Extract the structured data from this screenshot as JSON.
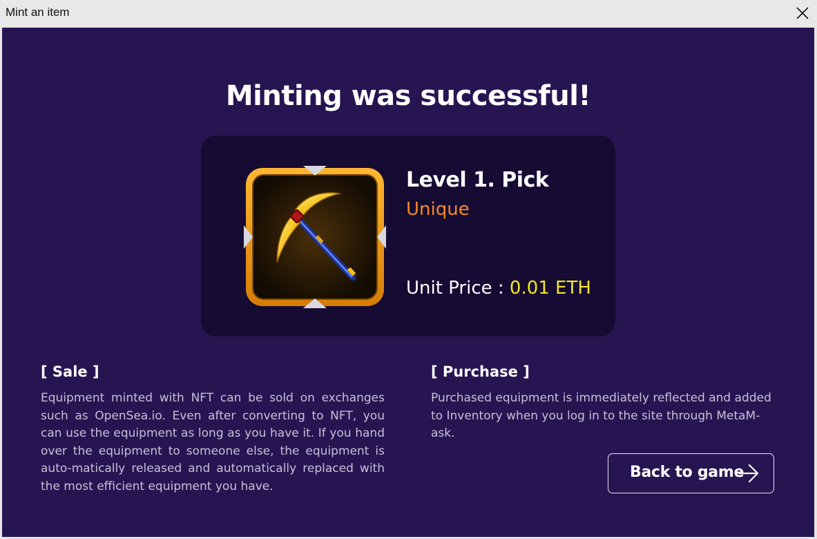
{
  "window": {
    "title": "Mint an item",
    "close_icon": "close-icon"
  },
  "main": {
    "heading": "Minting was successful!",
    "item": {
      "image_icon": "pickaxe-icon",
      "name": "Level 1. Pick",
      "rarity": "Unique",
      "price_label": "Unit Price : ",
      "price_value": "0.01 ETH"
    },
    "sale": {
      "title": "[ Sale ]",
      "body": "Equipment minted with NFT can be sold on exchanges such as OpenSea.io. Even after converting to NFT, you can use the equipment as long as you have it. If you hand over the equipment to someone else, the equipment is auto-matically released and automatically replaced with the most efficient equipment you have."
    },
    "purchase": {
      "title": "[ Purchase ]",
      "body": "Purchased equipment is immediately reflected and added to Inventory when you log in to the site through MetaM-ask."
    },
    "back_button": {
      "label": "Back to game",
      "icon": "arrow-right-icon"
    }
  },
  "colors": {
    "background": "#271552",
    "card": "#160b33",
    "rarity": "#f58a1f",
    "price": "#f5e81f",
    "frame": "#f2a11a"
  }
}
